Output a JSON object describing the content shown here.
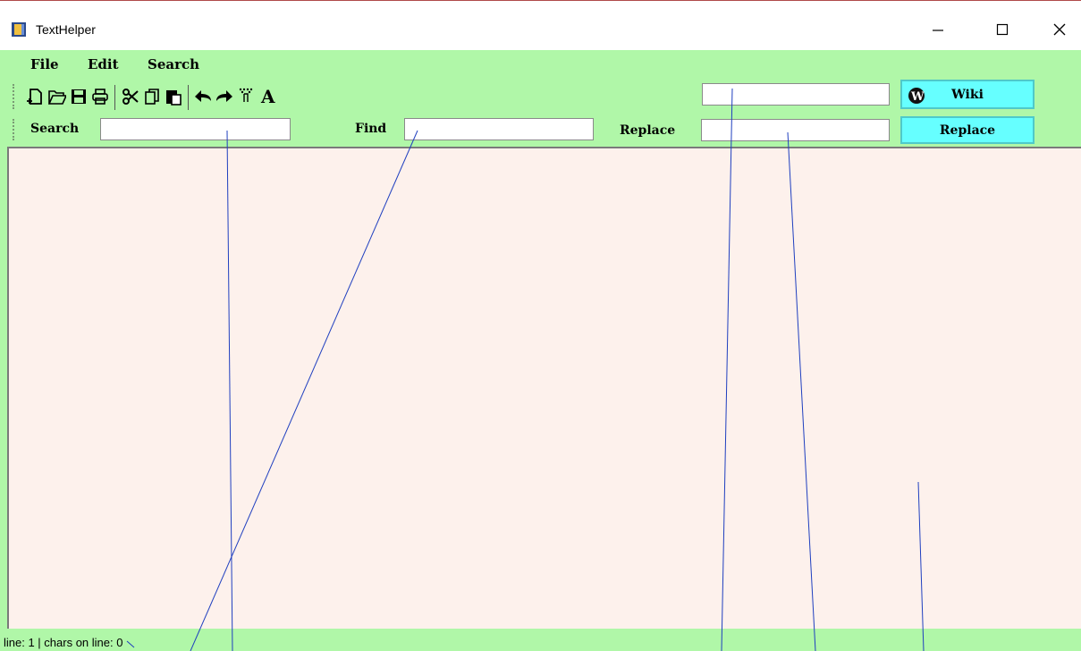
{
  "window": {
    "title": "TextHelper"
  },
  "menu": [
    {
      "id": "file",
      "label": "File"
    },
    {
      "id": "edit",
      "label": "Edit"
    },
    {
      "id": "search",
      "label": "Search"
    }
  ],
  "toolbar": {
    "icons": [
      "new-file-icon",
      "open-folder-icon",
      "save-icon",
      "print-icon",
      "cut-icon",
      "copy-icon",
      "paste-icon",
      "undo-icon",
      "redo-icon",
      "select-icon",
      "font-icon"
    ],
    "wiki_input": {
      "value": "",
      "placeholder": ""
    },
    "wiki_button": "Wiki",
    "wiki_icon": "wikipedia-icon"
  },
  "search_bar": {
    "search_label": "Search",
    "search_value": "",
    "find_label": "Find",
    "find_value": "",
    "replace_label": "Replace",
    "replace_value": "",
    "replace_button": "Replace"
  },
  "editor": {
    "text": ""
  },
  "status": {
    "text": "line: 1 | chars on line: 0"
  },
  "colors": {
    "chrome": "#b0f7a8",
    "editor_bg": "#fdf1ec",
    "button": "#66ffff",
    "annotation_lines": "#1f3fbf"
  }
}
